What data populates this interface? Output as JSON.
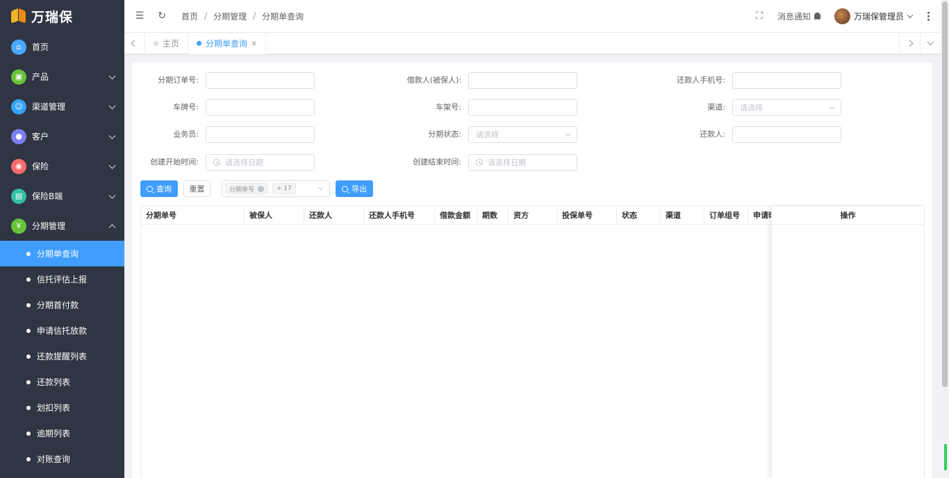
{
  "app": {
    "brand": "万瑞保"
  },
  "sidebar": {
    "menu": [
      {
        "label": "首页",
        "icon": "home-icon",
        "color": "#4aa8ff",
        "expandable": false
      },
      {
        "label": "产品",
        "icon": "bag-icon",
        "color": "#67c23a",
        "expandable": true
      },
      {
        "label": "渠道管理",
        "icon": "channel-icon",
        "color": "#36a3f7",
        "expandable": true
      },
      {
        "label": "客户",
        "icon": "user-icon",
        "color": "#7b7ff0",
        "expandable": true
      },
      {
        "label": "保险",
        "icon": "location-icon",
        "color": "#f56c6c",
        "expandable": true
      },
      {
        "label": "保险B端",
        "icon": "card-icon",
        "color": "#34bfa3",
        "expandable": true
      },
      {
        "label": "分期管理",
        "icon": "yen-icon",
        "color": "#67c23a",
        "expandable": true,
        "expanded": true
      }
    ],
    "submenu": [
      {
        "label": "分期单查询",
        "active": true
      },
      {
        "label": "信托评估上报"
      },
      {
        "label": "分期首付款"
      },
      {
        "label": "申请信托放款"
      },
      {
        "label": "还款提醒列表"
      },
      {
        "label": "还款列表"
      },
      {
        "label": "划扣列表"
      },
      {
        "label": "逾期列表"
      },
      {
        "label": "对账查询"
      }
    ]
  },
  "header": {
    "breadcrumb": [
      "首页",
      "分期管理",
      "分期单查询"
    ],
    "notice": "消息通知",
    "user": "万瑞保管理员"
  },
  "tabs": [
    {
      "label": "主页",
      "active": false
    },
    {
      "label": "分期单查询",
      "active": true,
      "close": "×"
    }
  ],
  "form": {
    "row1": {
      "l1": "分期订单号:",
      "l2": "借款人(被保人):",
      "l3": "还款人手机号:"
    },
    "row2": {
      "l1": "车牌号:",
      "l2": "车架号:",
      "l3": "渠道:",
      "p3": "请选择"
    },
    "row3": {
      "l1": "业务员:",
      "l2": "分期状态:",
      "p2": "请选择",
      "l3": "还款人:"
    },
    "row4": {
      "l1": "创建开始时间:",
      "p1": "请选择日期",
      "l2": "创建结束时间:",
      "p2": "请选择日期"
    }
  },
  "actions": {
    "search": "查询",
    "reset": "重置",
    "column_tag": "分期单号",
    "column_more": "+ 17",
    "export": "导出"
  },
  "table": {
    "columns": [
      "分期单号",
      "被保人",
      "还款人",
      "还款人手机号",
      "借款金额",
      "期数",
      "资方",
      "投保单号",
      "状态",
      "渠道",
      "订单组号",
      "申请时间"
    ],
    "operation": "操作"
  },
  "colors": {
    "primary": "#409eff",
    "sidebar_bg": "#2f3542"
  }
}
